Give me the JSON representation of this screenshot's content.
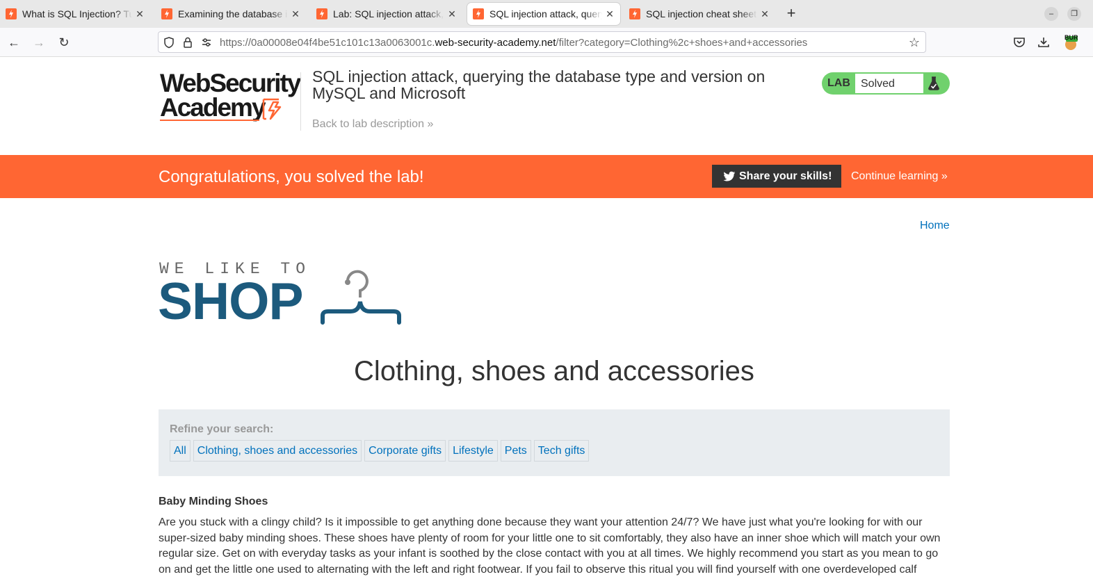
{
  "browser": {
    "tabs": [
      {
        "title": "What is SQL Injection? Tutorial"
      },
      {
        "title": "Examining the database in SQL"
      },
      {
        "title": "Lab: SQL injection attack, querying"
      },
      {
        "title": "SQL injection attack, querying the"
      },
      {
        "title": "SQL injection cheat sheet"
      }
    ],
    "new_tab_label": "+",
    "url": {
      "prefix": "https://0a00008e04f4be51c101c13a0063001c.",
      "host": "web-security-academy.net",
      "path": "/filter?category=Clothing%2c+shoes+and+accessories"
    },
    "extension_badge": "BUR"
  },
  "academy": {
    "logo_line1": "WebSecurity",
    "logo_line2": "Academy",
    "lab_title": "SQL injection attack, querying the database type and version on MySQL and Microsoft",
    "back_link": "Back to lab description",
    "badge_label": "LAB",
    "status": "Solved",
    "status_color": "#70d16d"
  },
  "banner": {
    "message": "Congratulations, you solved the lab!",
    "share_label": "Share your skills!",
    "continue_label": "Continue learning",
    "color": "#ff6633"
  },
  "shop": {
    "home_link": "Home",
    "logo_tagline": "WE LIKE TO",
    "logo_word": "SHOP",
    "category_title": "Clothing, shoes and accessories",
    "refine_label": "Refine your search:",
    "filters": [
      "All",
      "Clothing, shoes and accessories",
      "Corporate gifts",
      "Lifestyle",
      "Pets",
      "Tech gifts"
    ],
    "product": {
      "name": "Baby Minding Shoes",
      "description": "Are you stuck with a clingy child? Is it impossible to get anything done because they want your attention 24/7? We have just what you're looking for with our super-sized baby minding shoes. These shoes have plenty of room for your little one to sit comfortably, they also have an inner shoe which will match your own regular size. Get on with everyday tasks as your infant is soothed by the close contact with you at all times. We highly recommend you start as you mean to go on and get the little one used to alternating with the left and right footwear. If you fail to observe this ritual you will find yourself with one overdeveloped calf"
    },
    "link_color": "#0071bc",
    "brand_color": "#1c5a7d"
  }
}
